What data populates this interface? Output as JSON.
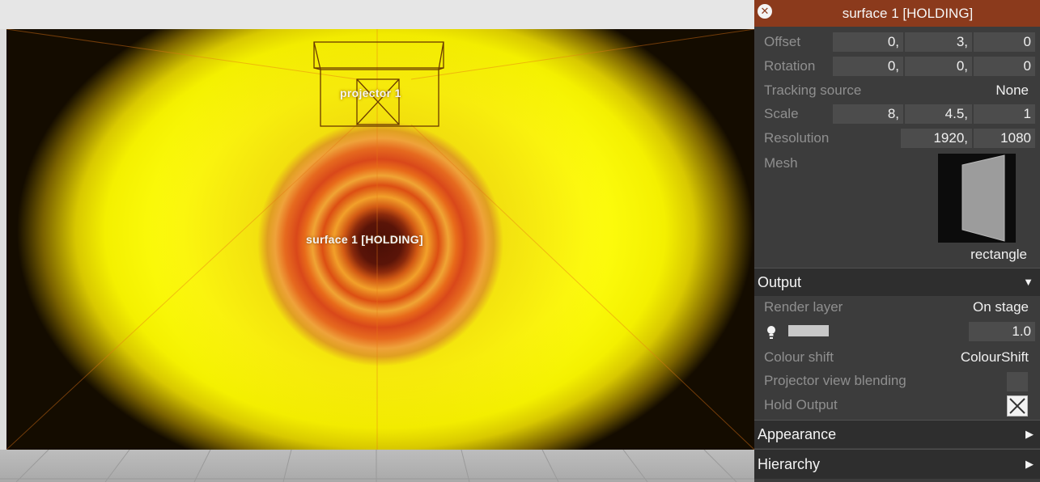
{
  "viewport": {
    "projector_label": "projector 1",
    "surface_label": "surface 1 [HOLDING]"
  },
  "panel": {
    "title": "surface 1 [HOLDING]",
    "offset": {
      "label": "Offset",
      "x": "0,",
      "y": "3,",
      "z": "0"
    },
    "rotation": {
      "label": "Rotation",
      "x": "0,",
      "y": "0,",
      "z": "0"
    },
    "tracking": {
      "label": "Tracking source",
      "value": "None"
    },
    "scale": {
      "label": "Scale",
      "x": "8,",
      "y": "4.5,",
      "z": "1"
    },
    "resolution": {
      "label": "Resolution",
      "w": "1920,",
      "h": "1080"
    },
    "mesh": {
      "label": "Mesh",
      "value": "rectangle"
    },
    "output": {
      "header": "Output",
      "render_layer": {
        "label": "Render layer",
        "value": "On stage"
      },
      "brightness": {
        "value": "1.0"
      },
      "colour_shift": {
        "label": "Colour shift",
        "value": "ColourShift"
      },
      "projector_view_blending": {
        "label": "Projector view blending",
        "checked": false
      },
      "hold_output": {
        "label": "Hold Output",
        "checked": true
      }
    },
    "appearance": {
      "header": "Appearance"
    },
    "hierarchy": {
      "header": "Hierarchy"
    }
  },
  "colors": {
    "title_bar": "#8b3a1c",
    "panel_bg": "#3c3c3c",
    "surface_yellow": "#ffff22",
    "ring_orange": "#dc4f13",
    "center_dark": "#4a0f06"
  },
  "icons": [
    "close-icon",
    "bulb-icon",
    "triangle-down-icon",
    "triangle-right-icon",
    "checkbox-cross-icon"
  ]
}
